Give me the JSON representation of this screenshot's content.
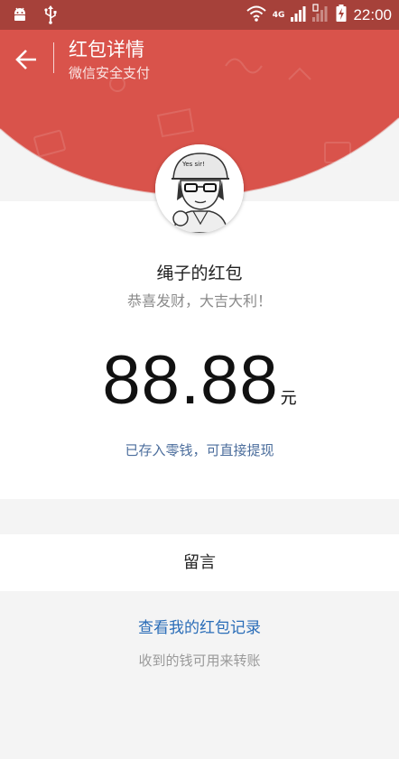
{
  "status_bar": {
    "network": "4G",
    "time": "22:00"
  },
  "header": {
    "title": "红包详情",
    "subtitle": "微信安全支付",
    "color": "#d9534b"
  },
  "avatar": {
    "caption": "Yes sir!"
  },
  "packet": {
    "sender": "绳子的红包",
    "greeting": "恭喜发财，大吉大利！",
    "amount": "88.88",
    "unit": "元",
    "deposited_text": "已存入零钱，可直接提现"
  },
  "message": {
    "label": "留言"
  },
  "footer": {
    "records_link": "查看我的红包记录",
    "note": "收到的钱可用来转账"
  }
}
